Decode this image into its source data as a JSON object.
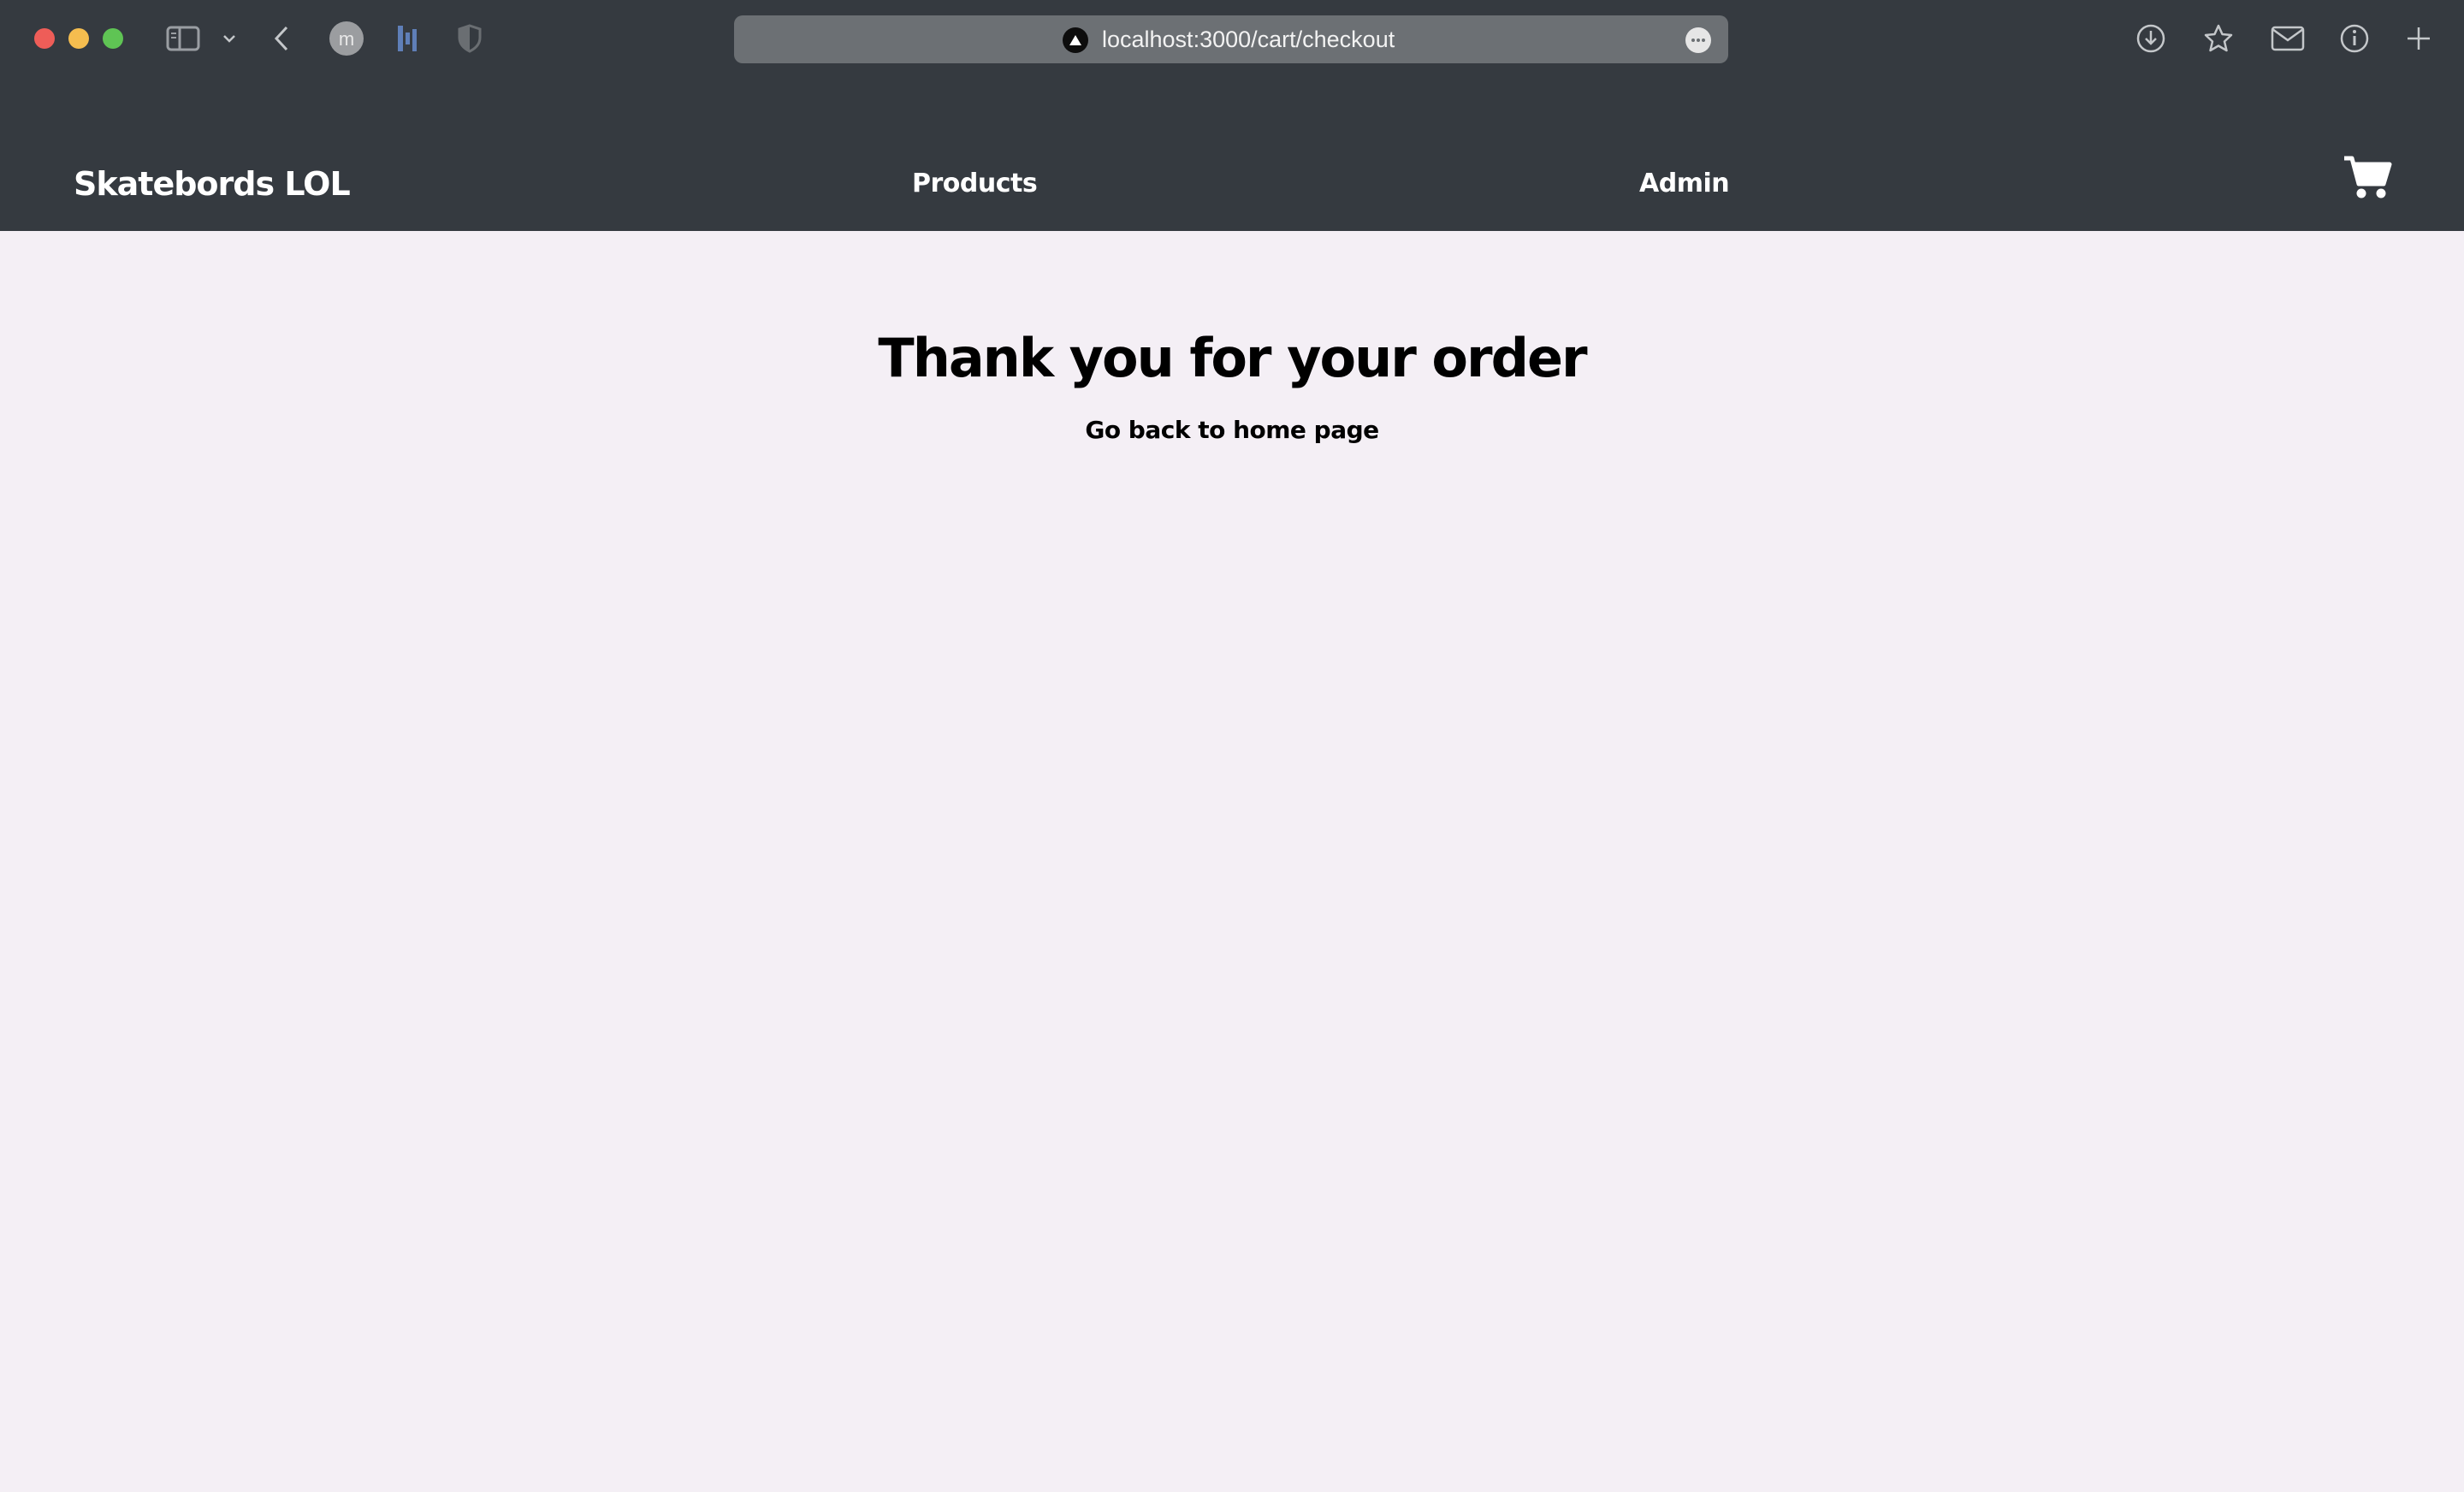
{
  "browser": {
    "url": "localhost:3000/cart/checkout",
    "profile_initial": "m"
  },
  "navbar": {
    "brand": "Skatebords LOL",
    "links": [
      {
        "label": "Products"
      },
      {
        "label": "Admin"
      }
    ],
    "cart_icon": "shopping-cart-icon"
  },
  "main": {
    "heading": "Thank you for your order",
    "home_link": "Go back to home page"
  },
  "colors": {
    "navbar_bg": "#353a40",
    "page_bg": "#f4eff5",
    "text_dark": "#000000",
    "text_light": "#ffffff"
  }
}
